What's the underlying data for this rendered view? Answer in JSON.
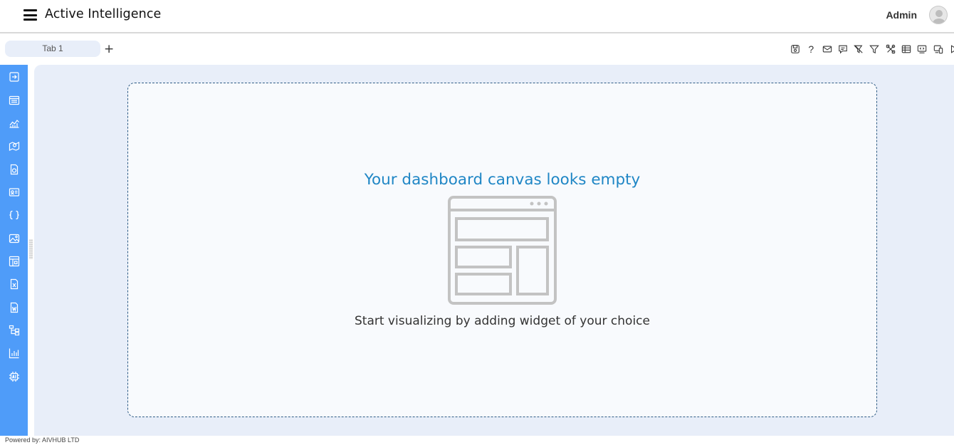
{
  "header": {
    "app_title": "Active Intelligence",
    "user_name": "Admin",
    "menu_icon": "hamburger-menu-icon",
    "avatar_icon": "user-avatar-icon"
  },
  "tabs": {
    "items": [
      {
        "label": "Tab 1"
      }
    ],
    "add_label": "+"
  },
  "toolbar": {
    "icons": [
      "save-icon",
      "help-icon",
      "mail-icon",
      "comment-icon",
      "clear-filter-icon",
      "filter-icon",
      "tools-icon",
      "table-icon",
      "embed-icon",
      "devices-icon",
      "play-icon"
    ],
    "help_label": "?"
  },
  "sidebar": {
    "icons": [
      "login-icon",
      "list-widget-icon",
      "area-chart-icon",
      "map-icon",
      "document-icon",
      "id-card-icon",
      "code-braces-icon",
      "image-icon",
      "layout-icon",
      "excel-file-icon",
      "word-file-icon",
      "hierarchy-icon",
      "bar-chart-icon",
      "ai-chip-icon"
    ],
    "accent_color": "#4f9cf9"
  },
  "canvas": {
    "empty_title": "Your dashboard canvas looks empty",
    "empty_subtitle": "Start visualizing by adding widget of your choice",
    "illustration_icon": "empty-dashboard-icon",
    "background_color": "#e8eef9",
    "title_color": "#1f86c5"
  },
  "footer": {
    "powered_by": "Powered by: AIVHUB LTD"
  }
}
